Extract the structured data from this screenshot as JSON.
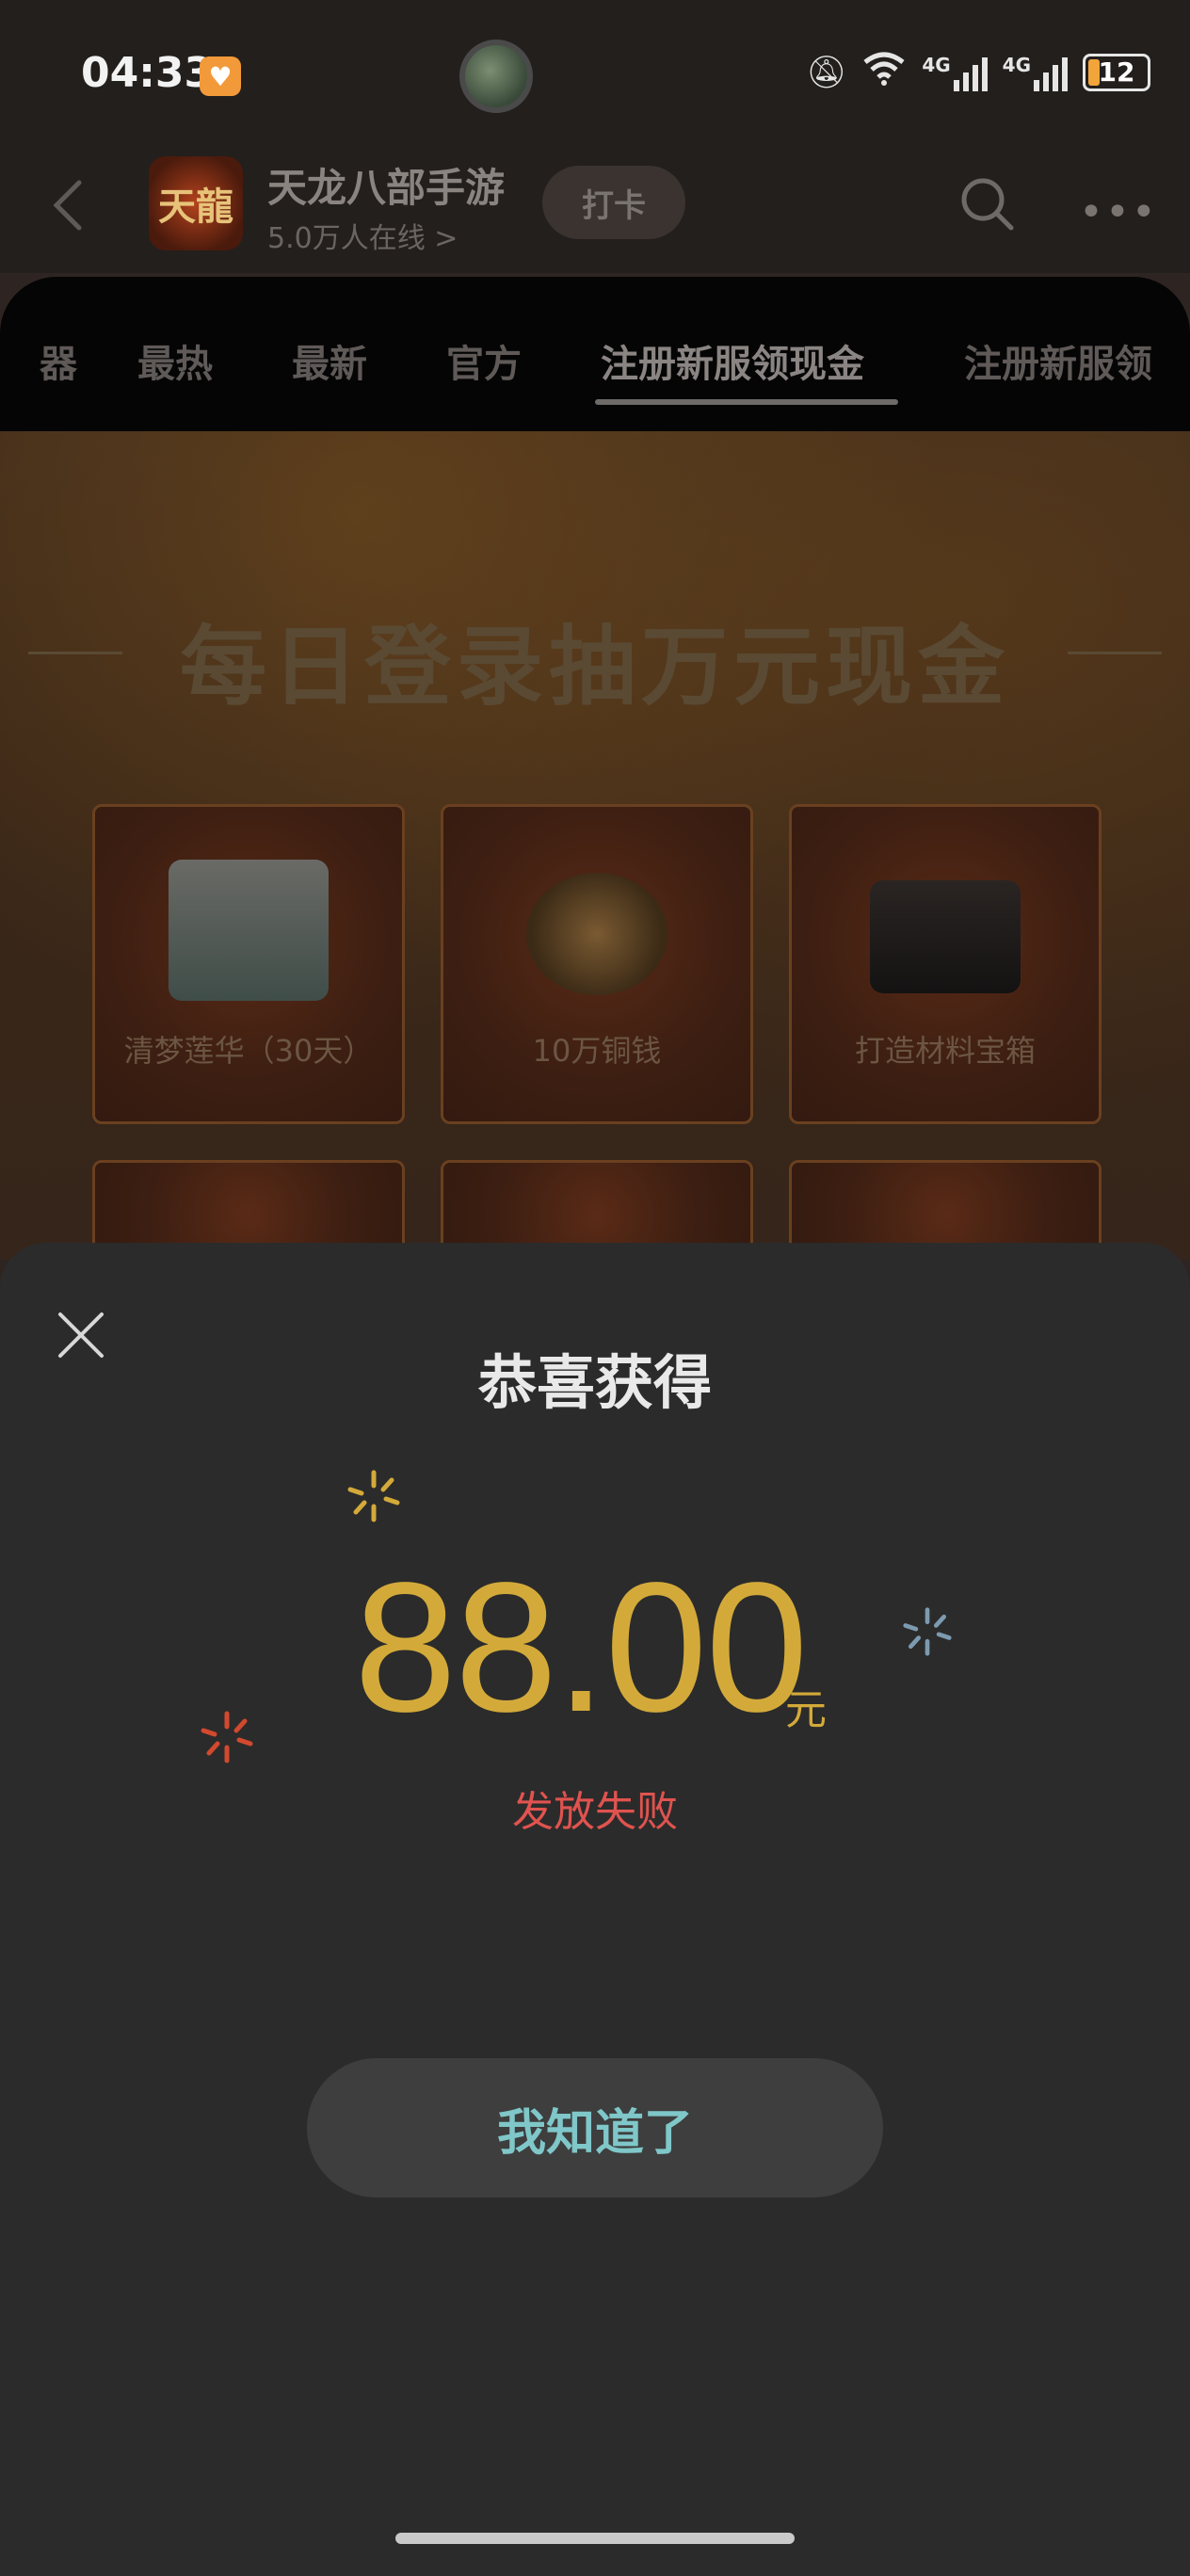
{
  "status_bar": {
    "time": "04:33",
    "network_1": "4G",
    "network_2": "4G",
    "battery": "12"
  },
  "app_bar": {
    "game_logo_text": "天龍",
    "title": "天龙八部手游",
    "online": "5.0万人在线 >",
    "checkin_label": "打卡"
  },
  "tabs": {
    "items": [
      "器",
      "最热",
      "最新",
      "官方",
      "注册新服领现金",
      "注册新服领"
    ],
    "active_index": 4
  },
  "banner": {
    "title": "每日登录抽万元现金",
    "prizes": [
      {
        "label": "清梦莲华（30天）",
        "icon": "costume-image"
      },
      {
        "label": "10万铜钱",
        "icon": "coins-image"
      },
      {
        "label": "打造材料宝箱",
        "icon": "treasure-chest-image"
      }
    ]
  },
  "modal": {
    "title": "恭喜获得",
    "amount": "88.00",
    "unit": "元",
    "status": "发放失败",
    "confirm_label": "我知道了"
  },
  "colors": {
    "amount": "#d3aa3a",
    "fail": "#e0534f",
    "button_text": "#7fc7c9",
    "sheet_bg": "#2b2b2b"
  }
}
